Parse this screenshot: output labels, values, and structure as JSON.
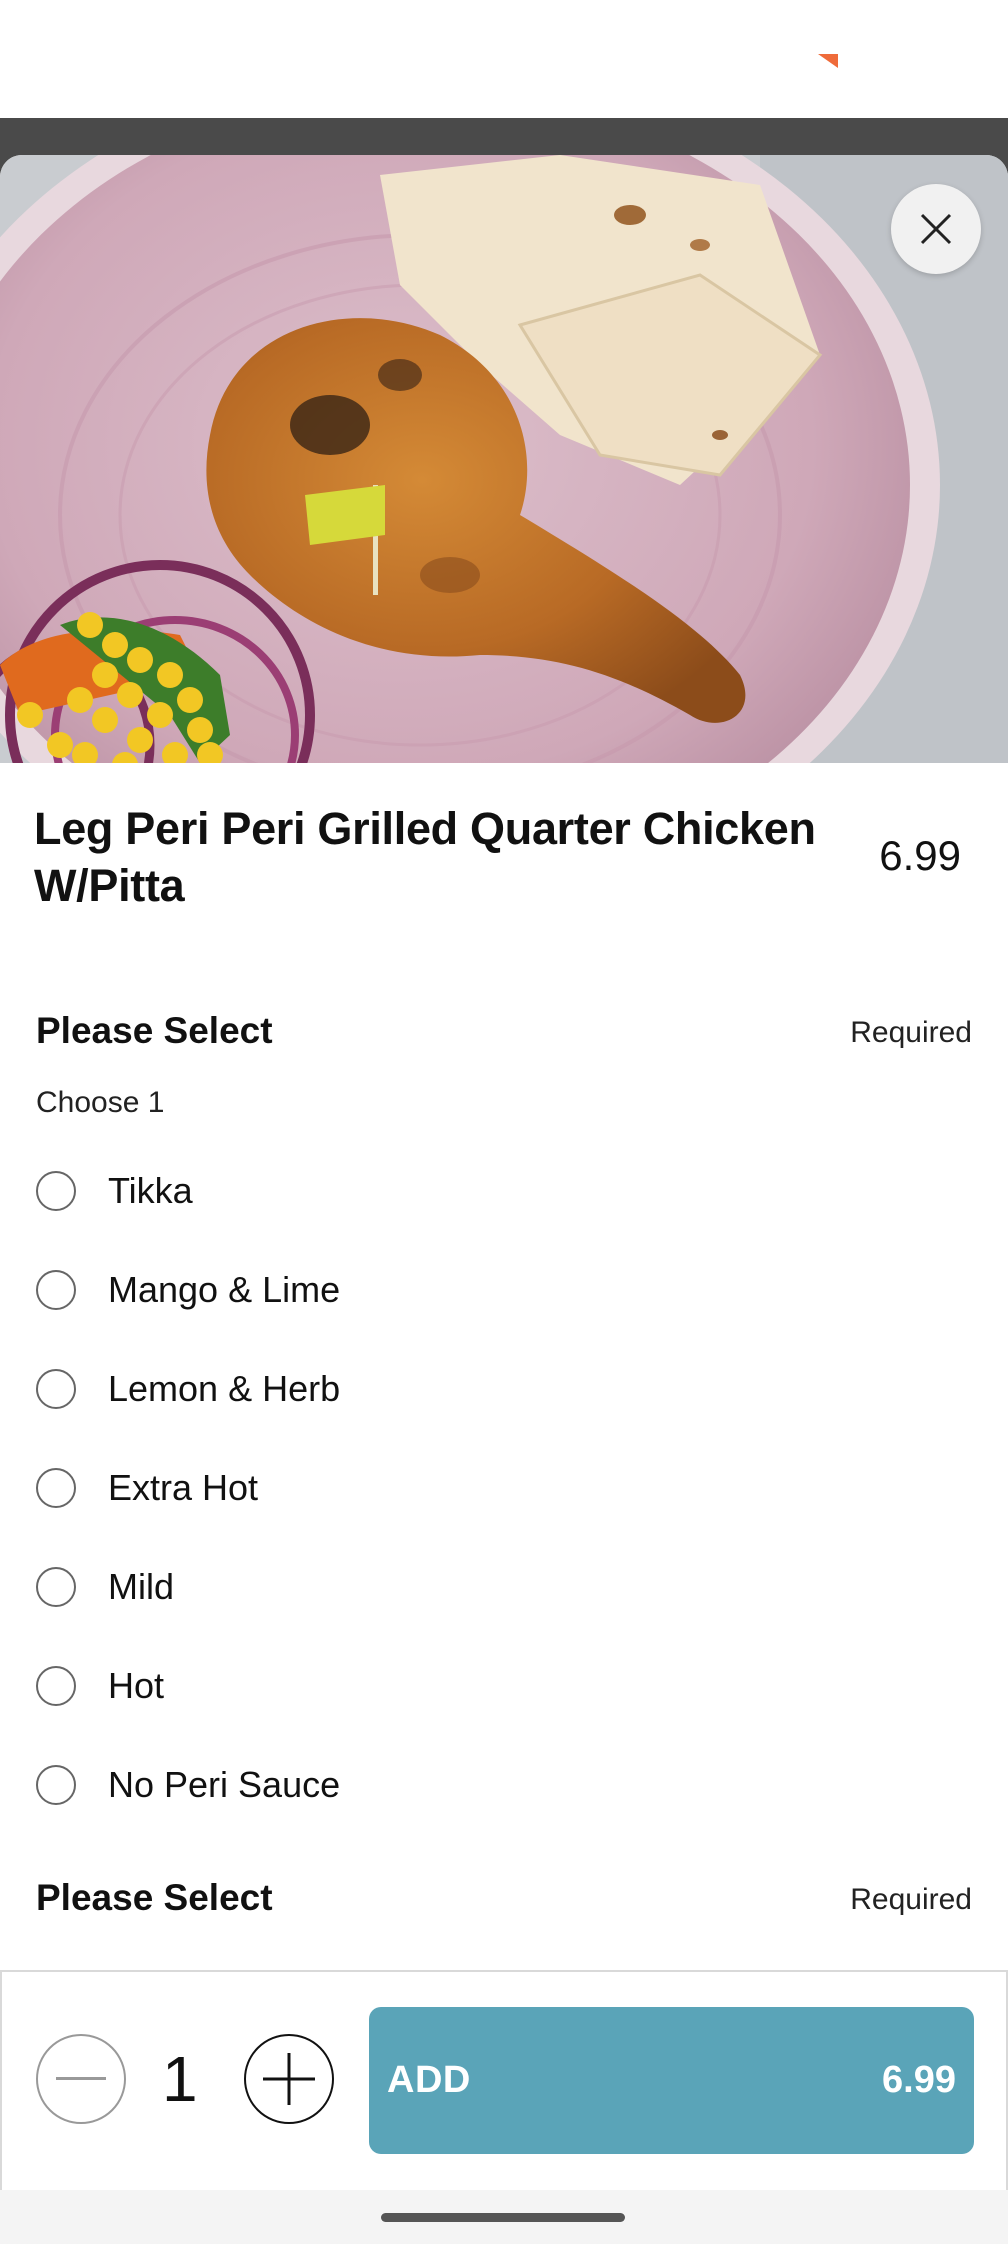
{
  "item": {
    "title": "Leg Peri Peri Grilled Quarter Chicken W/Pitta",
    "price": "6.99"
  },
  "groups": [
    {
      "title": "Please Select",
      "requirement": "Required",
      "instruction": "Choose 1",
      "options": [
        "Tikka",
        "Mango & Lime",
        "Lemon & Herb",
        "Extra Hot",
        "Mild",
        "Hot",
        "No Peri Sauce"
      ]
    },
    {
      "title": "Please Select",
      "requirement": "Required"
    }
  ],
  "footer": {
    "quantity": "1",
    "add_label": "ADD",
    "add_price": "6.99"
  },
  "icons": {
    "close": "close-icon",
    "minus": "minus-icon",
    "plus": "plus-icon"
  },
  "colors": {
    "add_button": "#5aa4b8",
    "accent": "#ef6b3a"
  }
}
